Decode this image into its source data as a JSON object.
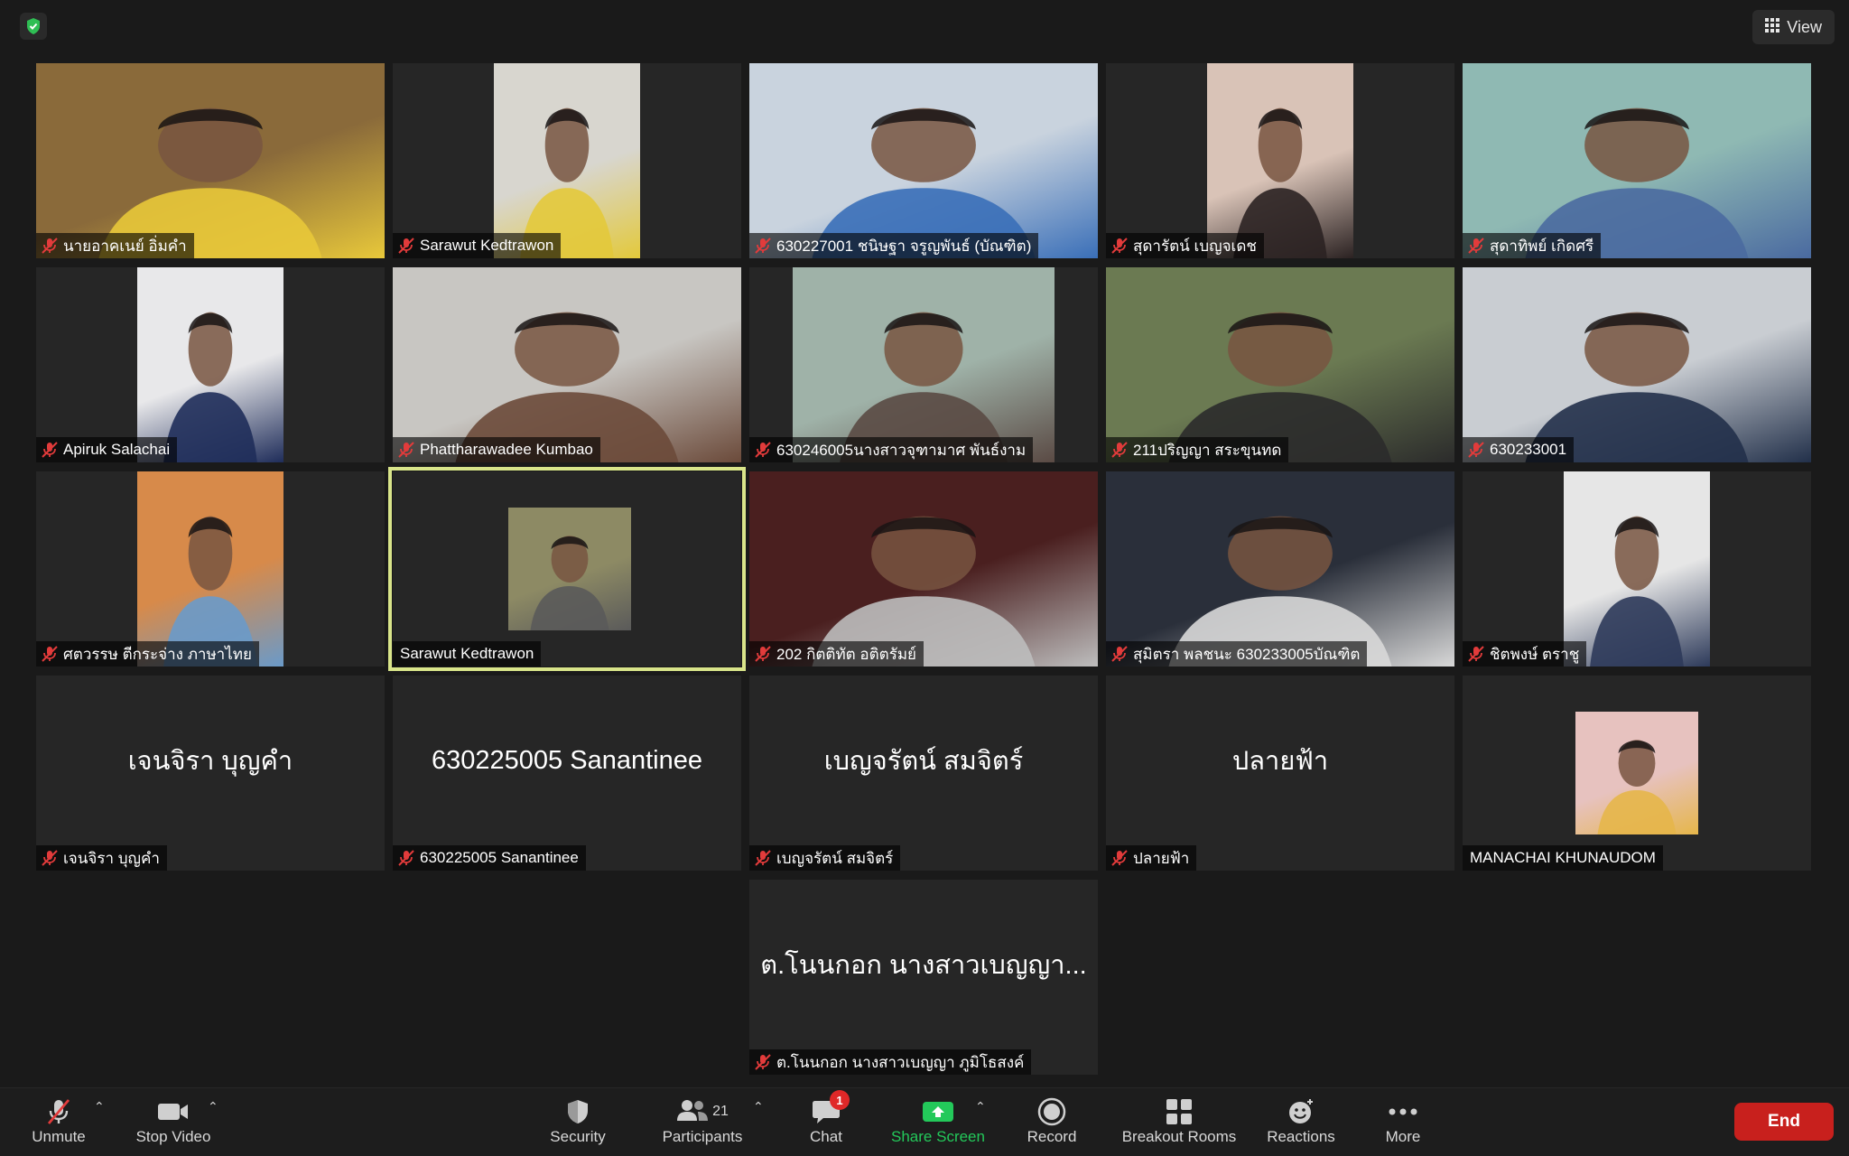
{
  "top": {
    "view_label": "View"
  },
  "participants_grid": {
    "row1": [
      {
        "name": "นายอาคเนย์ อิ่มคำ",
        "muted": true,
        "video_color": "#8a6a3a",
        "video_accent": "#e8c83a"
      },
      {
        "name": "Sarawut Kedtrawon",
        "muted": true,
        "video_color": "#d8d6cf",
        "video_accent": "#e3c93b"
      },
      {
        "name": "630227001 ชนิษฐา จรูญพันธ์ (บัณฑิต)",
        "muted": true,
        "video_color": "#c9d3de",
        "video_accent": "#3a6fb8"
      },
      {
        "name": "สุดารัตน์ เบญจเดช",
        "muted": true,
        "video_color": "#d9c3b7",
        "video_accent": "#2b2222"
      },
      {
        "name": "สุดาทิพย์ เกิดศรี",
        "muted": true,
        "video_color": "#8fb9b3",
        "video_accent": "#4a6aa0"
      }
    ],
    "row2": [
      {
        "name": "Apiruk Salachai",
        "muted": true,
        "video_color": "#e8e8ea",
        "video_accent": "#1f2d5a"
      },
      {
        "name": "Phattharawadee Kumbao",
        "muted": true,
        "video_color": "#c8c6c2",
        "video_accent": "#6b4a3a"
      },
      {
        "name": "630246005นางสาวจุฑามาศ พันธ์งาม",
        "muted": true,
        "video_color": "#9fb2a8",
        "video_accent": "#5a4a44"
      },
      {
        "name": "211ปริญญา สระขุนทด",
        "muted": true,
        "video_color": "#6b7a52",
        "video_accent": "#2b2b2b"
      },
      {
        "name": "630233001",
        "muted": true,
        "video_color": "#c9cdd2",
        "video_accent": "#22304a"
      }
    ],
    "row3": [
      {
        "name": "ศตวรรษ ตีกระจ่าง ภาษาไทย",
        "muted": true,
        "video_color": "#d78a4a",
        "video_accent": "#6a9ac9"
      },
      {
        "name": "Sarawut Kedtrawon",
        "muted": false,
        "speaking": true,
        "video_color": "#8d8a64",
        "video_accent": "#5a5a5a"
      },
      {
        "name": "202 กิตติทัต อติตรัมย์",
        "muted": true,
        "video_color": "#4a1f1f",
        "video_accent": "#bdbdbd"
      },
      {
        "name": "สุมิตรา พลชนะ 630233005บัณฑิต",
        "muted": true,
        "video_color": "#2a2f3a",
        "video_accent": "#d8d8d8"
      },
      {
        "name": "ชิตพงษ์ ตราชู",
        "muted": true,
        "video_color": "#e6e6e6",
        "video_accent": "#2d3a5a"
      }
    ],
    "row4": [
      {
        "name": "เจนจิรา บุญคำ",
        "muted": true,
        "center_name": "เจนจิรา บุญคำ"
      },
      {
        "name": "630225005 Sanantinee",
        "muted": true,
        "center_name": "630225005 Sanantinee"
      },
      {
        "name": "เบญจรัตน์ สมจิตร์",
        "muted": true,
        "center_name": "เบญจรัตน์ สมจิตร์"
      },
      {
        "name": "ปลายฟ้า",
        "muted": true,
        "center_name": "ปลายฟ้า"
      },
      {
        "name": "MANACHAI KHUNAUDOM",
        "muted": false,
        "video_color": "#e7c2bf",
        "video_accent": "#e6b64a"
      }
    ],
    "row5": [
      {
        "name": "ต.โนนกอก นางสาวเบญญา ภูมิโธสงค์",
        "muted": true,
        "center_name": "ต.โนนกอก นางสาวเบญญา..."
      }
    ]
  },
  "toolbar": {
    "unmute": "Unmute",
    "stop_video": "Stop Video",
    "security": "Security",
    "participants": "Participants",
    "participants_count": "21",
    "chat": "Chat",
    "chat_badge": "1",
    "share_screen": "Share Screen",
    "record": "Record",
    "breakout_rooms": "Breakout Rooms",
    "reactions": "Reactions",
    "more": "More",
    "end": "End"
  },
  "colors": {
    "share_green": "#23c95a",
    "end_red": "#c8201d",
    "speaker_outline": "#d9e58a",
    "muted_red": "#e23b3b"
  }
}
